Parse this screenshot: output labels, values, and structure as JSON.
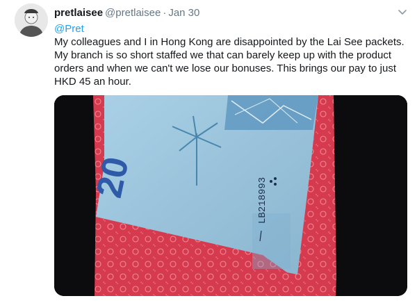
{
  "tweet": {
    "display_name": "pretlaisee",
    "handle": "@pretlaisee",
    "separator": "·",
    "time": "Jan 30",
    "mention": "@Pret",
    "text_lines": [
      "My colleagues and I in Hong Kong are disappointed  by the  Lai See packets.",
      "My branch is so short staffed we that can barely keep up with the product",
      "orders and when we can't we lose our bonuses. This brings our pay to just",
      "HKD 45 an hour."
    ]
  },
  "photo": {
    "banknote_denomination": "20",
    "serial_number": "LB218993",
    "colors": {
      "background": "#0c0b0d",
      "envelope": "#d63a4e",
      "banknote": "#9fc6de"
    }
  },
  "icons": {
    "caret": "chevron-down-icon",
    "avatar": "user-avatar"
  }
}
